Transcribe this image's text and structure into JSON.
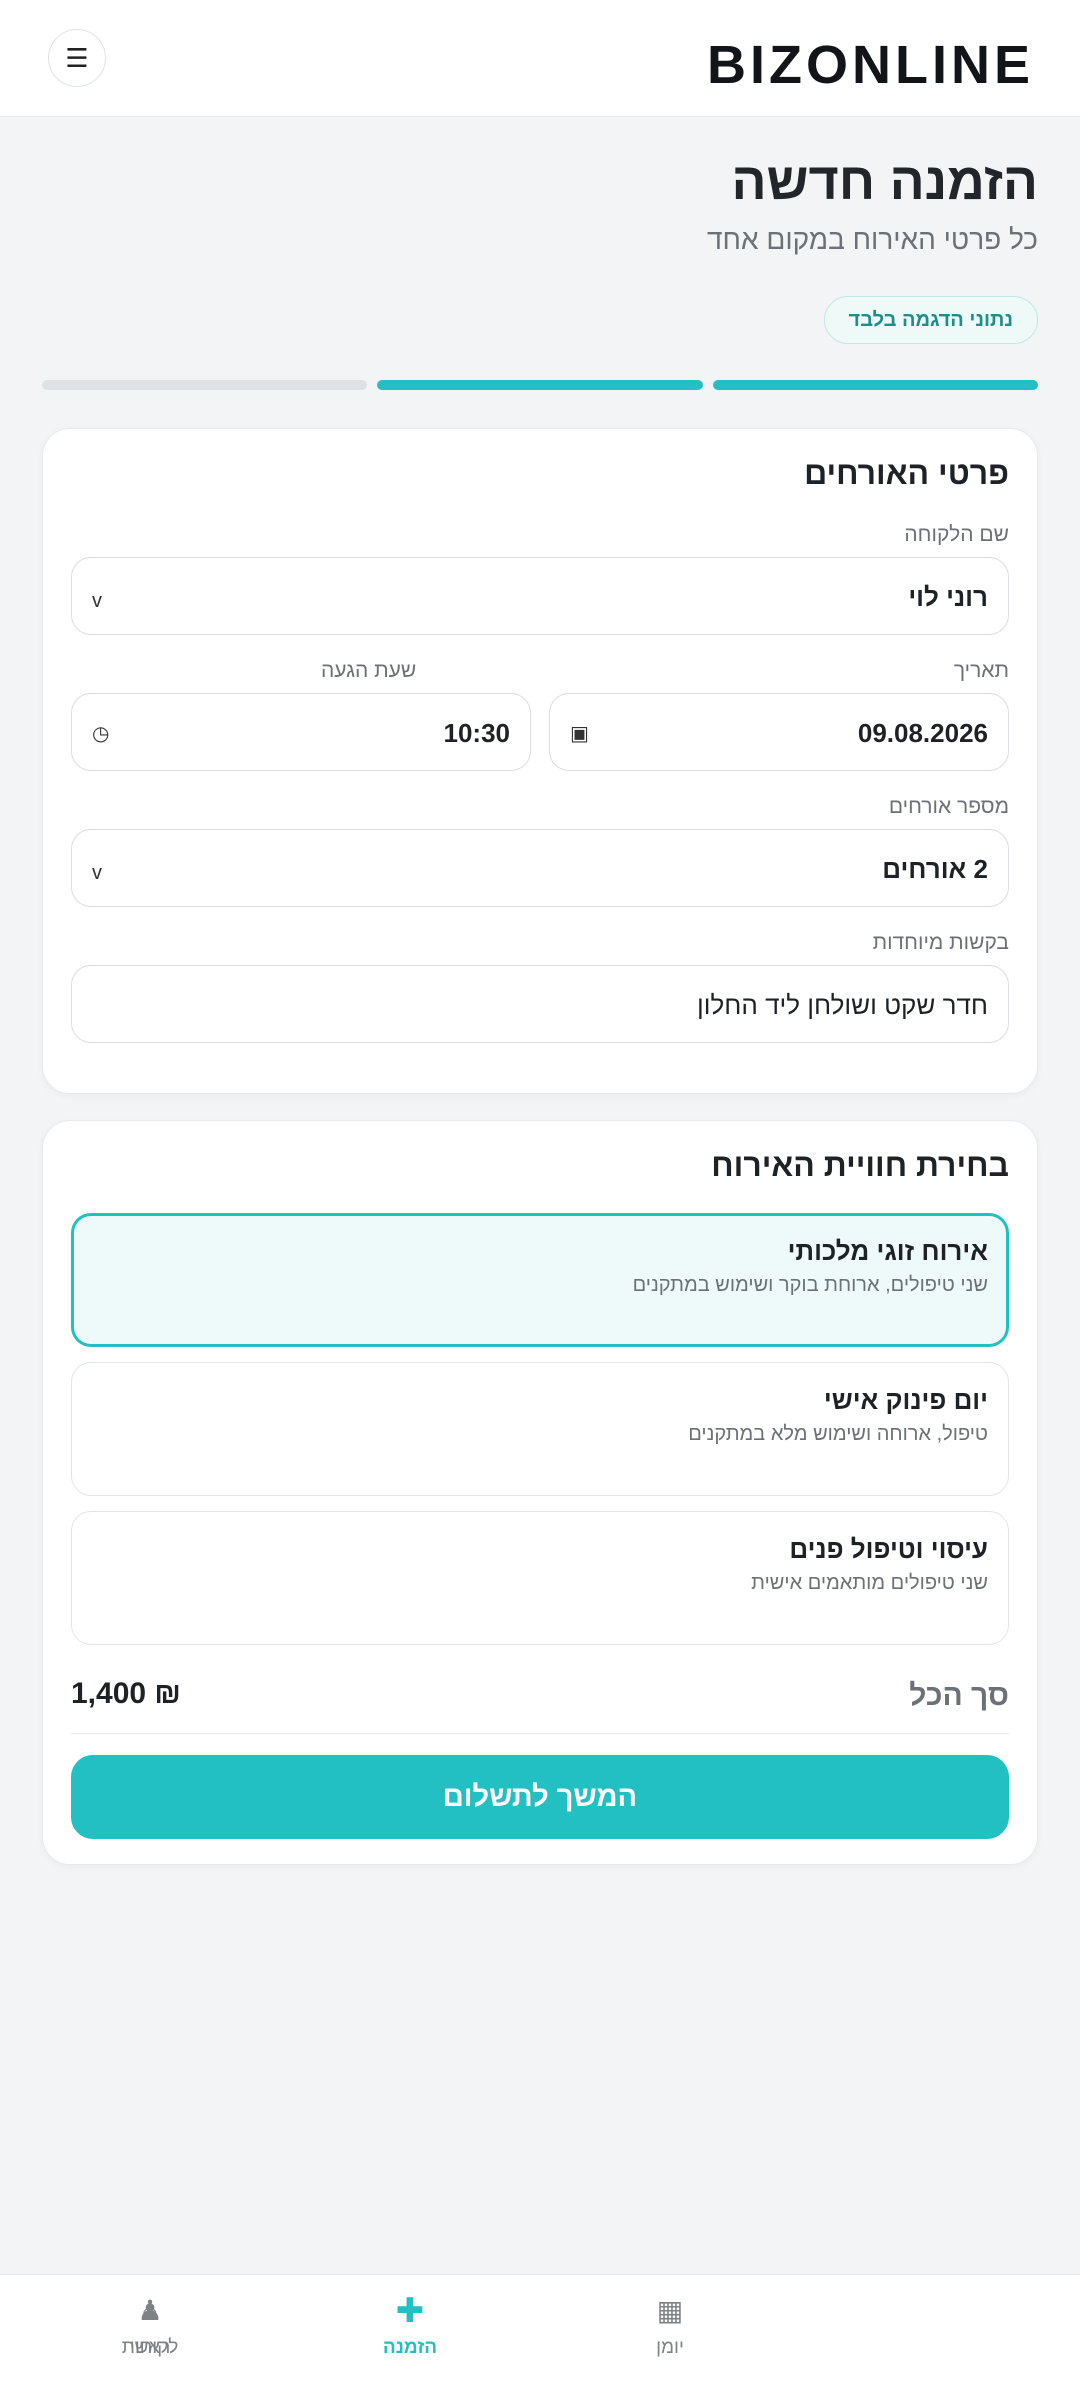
{
  "header": {
    "logo": "BIZONLINE",
    "menu_icon": "☰"
  },
  "page": {
    "title": "הזמנה חדשה",
    "subtitle": "כל פרטי האירוח במקום אחד",
    "badge": "נתוני הדגמה בלבד"
  },
  "progress": {
    "total_steps": 3,
    "completed_steps": 2
  },
  "guest_details": {
    "title": "פרטי האורחים",
    "customer_label": "שם הלקוחה",
    "customer_value": "רוני לוי",
    "date_label": "תאריך",
    "date_value": "09.08.2026",
    "time_label": "שעת הגעה",
    "time_value": "10:30",
    "guests_label": "מספר אורחים",
    "guests_value": "2 אורחים",
    "requests_label": "בקשות מיוחדות",
    "requests_value": "חדר שקט ושולחן ליד החלון",
    "dropdown_icon": "v",
    "calendar_icon": "▣",
    "clock_icon": "◷"
  },
  "experience": {
    "title": "בחירת חוויית האירוח",
    "options": [
      {
        "title": "אירוח זוגי מלכותי",
        "desc": "שני טיפולים, ארוחת בוקר ושימוש במתקנים",
        "selected": true
      },
      {
        "title": "יום פינוק אישי",
        "desc": "טיפול, ארוחה ושימוש מלא במתקנים",
        "selected": false
      },
      {
        "title": "עיסוי וטיפול פנים",
        "desc": "שני טיפולים מותאמים אישית",
        "selected": false
      }
    ],
    "total_label": "סך הכל",
    "total_value": "₪ 1,400",
    "cta": "המשך לתשלום"
  },
  "bottom_nav": [
    {
      "label": "ראשי",
      "icon": "⌂",
      "active": false
    },
    {
      "label": "יומן",
      "icon": "▦",
      "active": false
    },
    {
      "label": "הזמנה",
      "icon": "✚",
      "active": true
    },
    {
      "label": "לקוחות",
      "icon": "♟",
      "active": false
    }
  ],
  "colors": {
    "accent": "#22bfc3",
    "background": "#f2f4f6"
  }
}
